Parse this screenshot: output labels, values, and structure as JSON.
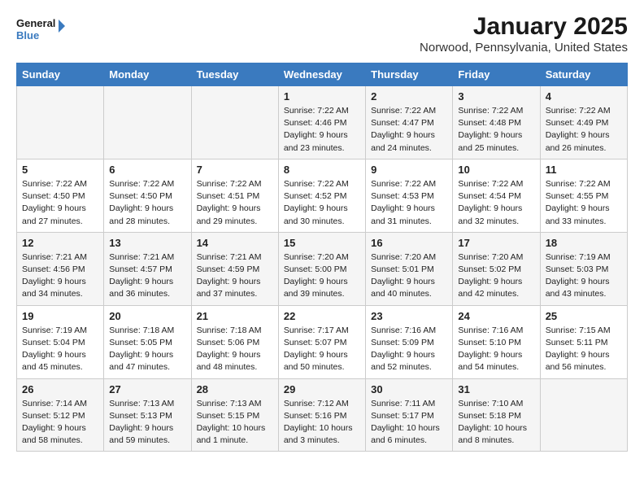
{
  "header": {
    "logo_line1": "General",
    "logo_line2": "Blue",
    "month": "January 2025",
    "location": "Norwood, Pennsylvania, United States"
  },
  "days_of_week": [
    "Sunday",
    "Monday",
    "Tuesday",
    "Wednesday",
    "Thursday",
    "Friday",
    "Saturday"
  ],
  "weeks": [
    [
      {
        "day": "",
        "info": ""
      },
      {
        "day": "",
        "info": ""
      },
      {
        "day": "",
        "info": ""
      },
      {
        "day": "1",
        "info": "Sunrise: 7:22 AM\nSunset: 4:46 PM\nDaylight: 9 hours\nand 23 minutes."
      },
      {
        "day": "2",
        "info": "Sunrise: 7:22 AM\nSunset: 4:47 PM\nDaylight: 9 hours\nand 24 minutes."
      },
      {
        "day": "3",
        "info": "Sunrise: 7:22 AM\nSunset: 4:48 PM\nDaylight: 9 hours\nand 25 minutes."
      },
      {
        "day": "4",
        "info": "Sunrise: 7:22 AM\nSunset: 4:49 PM\nDaylight: 9 hours\nand 26 minutes."
      }
    ],
    [
      {
        "day": "5",
        "info": "Sunrise: 7:22 AM\nSunset: 4:50 PM\nDaylight: 9 hours\nand 27 minutes."
      },
      {
        "day": "6",
        "info": "Sunrise: 7:22 AM\nSunset: 4:50 PM\nDaylight: 9 hours\nand 28 minutes."
      },
      {
        "day": "7",
        "info": "Sunrise: 7:22 AM\nSunset: 4:51 PM\nDaylight: 9 hours\nand 29 minutes."
      },
      {
        "day": "8",
        "info": "Sunrise: 7:22 AM\nSunset: 4:52 PM\nDaylight: 9 hours\nand 30 minutes."
      },
      {
        "day": "9",
        "info": "Sunrise: 7:22 AM\nSunset: 4:53 PM\nDaylight: 9 hours\nand 31 minutes."
      },
      {
        "day": "10",
        "info": "Sunrise: 7:22 AM\nSunset: 4:54 PM\nDaylight: 9 hours\nand 32 minutes."
      },
      {
        "day": "11",
        "info": "Sunrise: 7:22 AM\nSunset: 4:55 PM\nDaylight: 9 hours\nand 33 minutes."
      }
    ],
    [
      {
        "day": "12",
        "info": "Sunrise: 7:21 AM\nSunset: 4:56 PM\nDaylight: 9 hours\nand 34 minutes."
      },
      {
        "day": "13",
        "info": "Sunrise: 7:21 AM\nSunset: 4:57 PM\nDaylight: 9 hours\nand 36 minutes."
      },
      {
        "day": "14",
        "info": "Sunrise: 7:21 AM\nSunset: 4:59 PM\nDaylight: 9 hours\nand 37 minutes."
      },
      {
        "day": "15",
        "info": "Sunrise: 7:20 AM\nSunset: 5:00 PM\nDaylight: 9 hours\nand 39 minutes."
      },
      {
        "day": "16",
        "info": "Sunrise: 7:20 AM\nSunset: 5:01 PM\nDaylight: 9 hours\nand 40 minutes."
      },
      {
        "day": "17",
        "info": "Sunrise: 7:20 AM\nSunset: 5:02 PM\nDaylight: 9 hours\nand 42 minutes."
      },
      {
        "day": "18",
        "info": "Sunrise: 7:19 AM\nSunset: 5:03 PM\nDaylight: 9 hours\nand 43 minutes."
      }
    ],
    [
      {
        "day": "19",
        "info": "Sunrise: 7:19 AM\nSunset: 5:04 PM\nDaylight: 9 hours\nand 45 minutes."
      },
      {
        "day": "20",
        "info": "Sunrise: 7:18 AM\nSunset: 5:05 PM\nDaylight: 9 hours\nand 47 minutes."
      },
      {
        "day": "21",
        "info": "Sunrise: 7:18 AM\nSunset: 5:06 PM\nDaylight: 9 hours\nand 48 minutes."
      },
      {
        "day": "22",
        "info": "Sunrise: 7:17 AM\nSunset: 5:07 PM\nDaylight: 9 hours\nand 50 minutes."
      },
      {
        "day": "23",
        "info": "Sunrise: 7:16 AM\nSunset: 5:09 PM\nDaylight: 9 hours\nand 52 minutes."
      },
      {
        "day": "24",
        "info": "Sunrise: 7:16 AM\nSunset: 5:10 PM\nDaylight: 9 hours\nand 54 minutes."
      },
      {
        "day": "25",
        "info": "Sunrise: 7:15 AM\nSunset: 5:11 PM\nDaylight: 9 hours\nand 56 minutes."
      }
    ],
    [
      {
        "day": "26",
        "info": "Sunrise: 7:14 AM\nSunset: 5:12 PM\nDaylight: 9 hours\nand 58 minutes."
      },
      {
        "day": "27",
        "info": "Sunrise: 7:13 AM\nSunset: 5:13 PM\nDaylight: 9 hours\nand 59 minutes."
      },
      {
        "day": "28",
        "info": "Sunrise: 7:13 AM\nSunset: 5:15 PM\nDaylight: 10 hours\nand 1 minute."
      },
      {
        "day": "29",
        "info": "Sunrise: 7:12 AM\nSunset: 5:16 PM\nDaylight: 10 hours\nand 3 minutes."
      },
      {
        "day": "30",
        "info": "Sunrise: 7:11 AM\nSunset: 5:17 PM\nDaylight: 10 hours\nand 6 minutes."
      },
      {
        "day": "31",
        "info": "Sunrise: 7:10 AM\nSunset: 5:18 PM\nDaylight: 10 hours\nand 8 minutes."
      },
      {
        "day": "",
        "info": ""
      }
    ]
  ]
}
